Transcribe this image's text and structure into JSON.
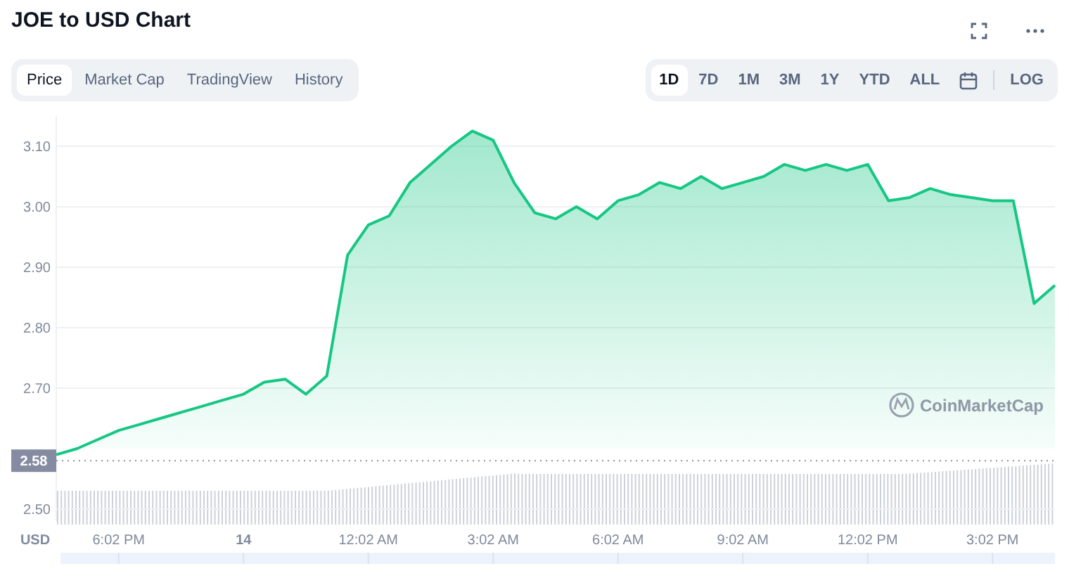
{
  "title": "JOE to USD Chart",
  "view_tabs": [
    {
      "label": "Price",
      "selected": true
    },
    {
      "label": "Market Cap",
      "selected": false
    },
    {
      "label": "TradingView",
      "selected": false
    },
    {
      "label": "History",
      "selected": false
    }
  ],
  "range_tabs": [
    {
      "label": "1D",
      "selected": true
    },
    {
      "label": "7D",
      "selected": false
    },
    {
      "label": "1M",
      "selected": false
    },
    {
      "label": "3M",
      "selected": false
    },
    {
      "label": "1Y",
      "selected": false
    },
    {
      "label": "YTD",
      "selected": false
    },
    {
      "label": "ALL",
      "selected": false
    }
  ],
  "log_button": "LOG",
  "chart": {
    "currency": "USD",
    "watermark": "CoinMarketCap",
    "chart_data": {
      "type": "area",
      "grid": true,
      "ref_lines": [
        {
          "axis": "y",
          "value": 2.58,
          "label": "2.58"
        }
      ],
      "categories": [
        null,
        null,
        null,
        "6:02 PM",
        null,
        null,
        null,
        null,
        null,
        "14",
        null,
        null,
        null,
        null,
        null,
        "12:02 AM",
        null,
        null,
        null,
        null,
        null,
        "3:02 AM",
        null,
        null,
        null,
        null,
        null,
        "6:02 AM",
        null,
        null,
        null,
        null,
        null,
        "9:02 AM",
        null,
        null,
        null,
        null,
        null,
        "12:02 PM",
        null,
        null,
        null,
        null,
        null,
        "3:02 PM",
        null,
        null,
        null
      ],
      "series": [
        {
          "color": "#16c784",
          "values": [
            2.59,
            2.6,
            2.615,
            2.63,
            2.64,
            2.65,
            2.66,
            2.67,
            2.68,
            2.69,
            2.71,
            2.715,
            2.69,
            2.72,
            2.92,
            2.97,
            2.985,
            3.04,
            3.07,
            3.1,
            3.125,
            3.11,
            3.04,
            2.99,
            2.98,
            3.0,
            2.98,
            3.01,
            3.02,
            3.04,
            3.03,
            3.05,
            3.03,
            3.04,
            3.05,
            3.07,
            3.06,
            3.07,
            3.06,
            3.07,
            3.01,
            3.015,
            3.03,
            3.02,
            3.015,
            3.01,
            3.01,
            2.84,
            2.87
          ]
        }
      ],
      "ylim": [
        2.48,
        3.15
      ],
      "yticks": [
        {
          "value": 2.5,
          "label": "2.50"
        },
        {
          "value": 2.7,
          "label": "2.70"
        },
        {
          "value": 2.8,
          "label": "2.80"
        },
        {
          "value": 2.9,
          "label": "2.90"
        },
        {
          "value": 3.0,
          "label": "3.00"
        },
        {
          "value": 3.1,
          "label": "3.10"
        }
      ]
    }
  }
}
